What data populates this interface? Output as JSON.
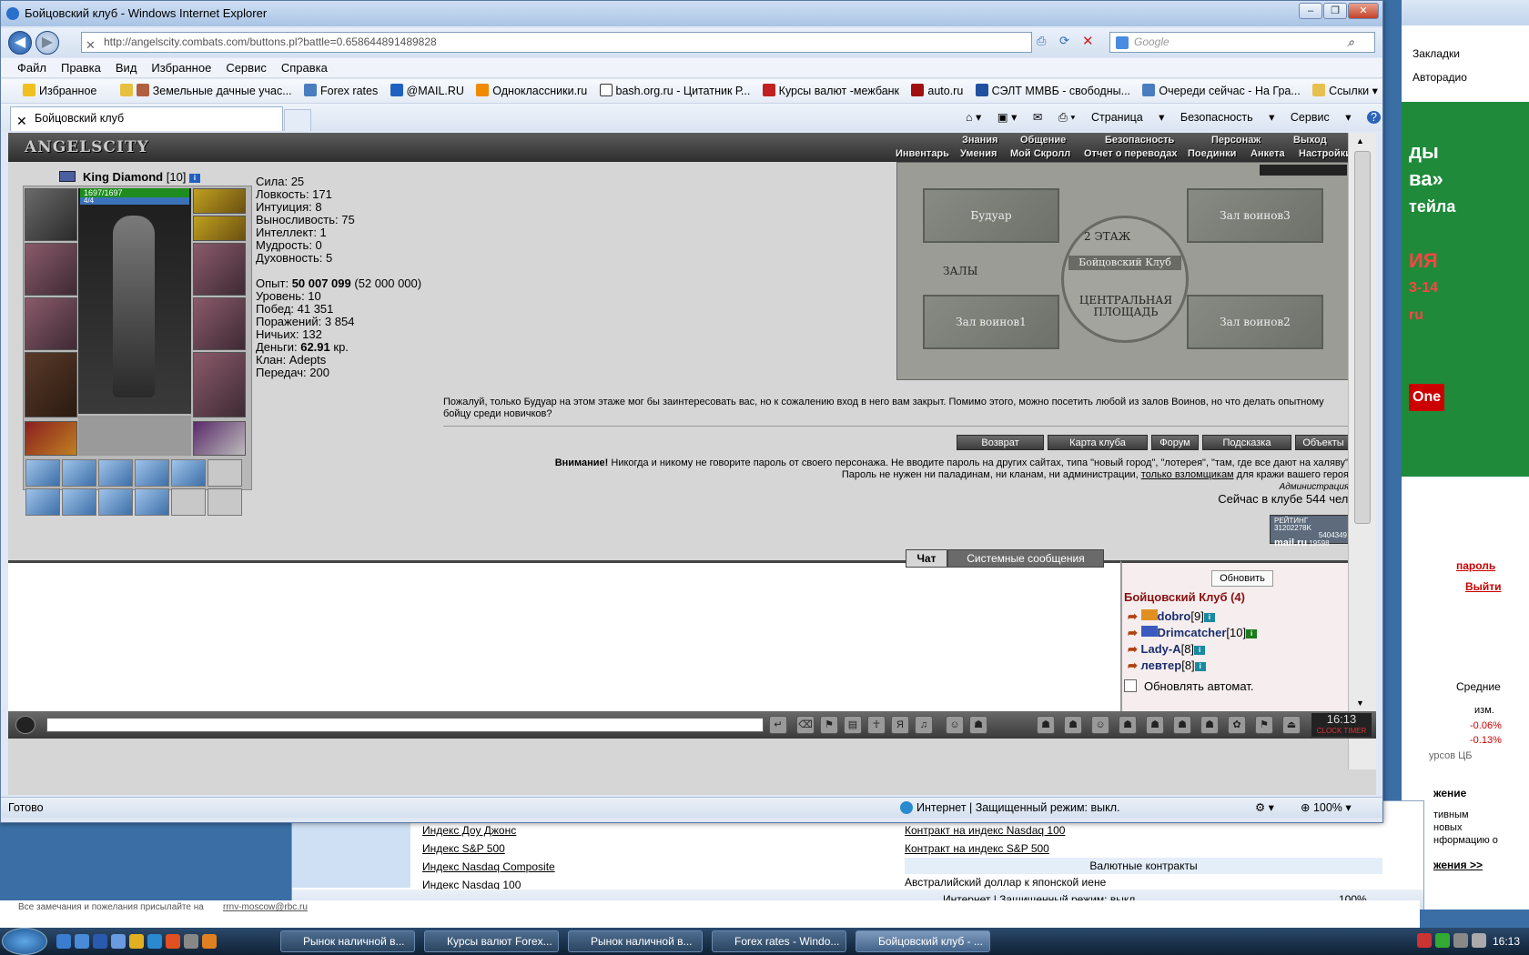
{
  "window": {
    "title": "Бойцовский клуб - Windows Internet Explorer"
  },
  "address": {
    "url": "http://angelscity.combats.com/buttons.pl?battle=0.658644891489828"
  },
  "search": {
    "placeholder": "Google"
  },
  "menu": [
    "Файл",
    "Правка",
    "Вид",
    "Избранное",
    "Сервис",
    "Справка"
  ],
  "favorites": {
    "label": "Избранное",
    "items": [
      "Земельные дачные учас...",
      "Forex rates",
      "@MAIL.RU",
      "Одноклассники.ru",
      "bash.org.ru - Цитатник Р...",
      "Курсы валют -межбанк",
      "auto.ru",
      "СЭЛТ ММВБ - свободны...",
      "Очереди сейчас - На Гра...",
      "Ссылки"
    ]
  },
  "tab": {
    "label": "Бойцовский клуб"
  },
  "commands": [
    "Страница",
    "Безопасность",
    "Сервис"
  ],
  "game": {
    "logo": "ANGELSCITY",
    "menu_top": [
      "Знания",
      "Общение",
      "Безопасность",
      "Персонаж",
      "Выход"
    ],
    "menu_bottom": [
      "Инвентарь",
      "Умения",
      "Мой Скролл",
      "Отчет о переводах",
      "Поединки",
      "Анкета",
      "Настройки"
    ],
    "character": {
      "name": "King Diamond",
      "level": "[10]",
      "hp": "1697/1697",
      "mana": "4/4"
    },
    "stats": {
      "strength": "Сила: 25",
      "agility": "Ловкость: 171",
      "intuition": "Интуиция: 8",
      "endurance": "Выносливость: 75",
      "intellect": "Интеллект: 1",
      "wisdom": "Мудрость: 0",
      "spirit": "Духовность: 5",
      "exp_label": "Опыт: ",
      "exp_value": "50 007 099",
      "exp_next": " (52 000 000)",
      "level": "Уровень: 10",
      "wins": "Побед: 41 351",
      "losses": "Поражений: 3 854",
      "draws": "Ничьих: 132",
      "money_label": "Деньги: ",
      "money_value": "62.91",
      "money_unit": " кр.",
      "clan": "Клан: Adepts",
      "transfers": "Передач: 200"
    },
    "map": {
      "rooms": [
        "Будуар",
        "Зал воинов3",
        "Зал воинов1",
        "Зал воинов2"
      ],
      "floor": "2 ЭТАЖ",
      "center": "Бойцовский Клуб",
      "halls": "ЗАЛЫ",
      "square_1": "ЦЕНТРАЛЬНАЯ",
      "square_2": "ПЛОЩАДЬ"
    },
    "description": "Пожалуй, только Будуар на этом этаже мог бы заинтересовать вас, но к сожалению вход в него вам закрыт. Помимо этого, можно посетить любой из залов Воинов, но что делать опытному бойцу среди новичков?",
    "buttons": [
      "Возврат",
      "Карта клуба",
      "Форум",
      "Подсказка",
      "Объекты"
    ],
    "warning": {
      "bold": "Внимание!",
      "line1": " Никогда и никому не говорите пароль от своего персонажа. Не вводите пароль на других сайтах, типа \"новый город\", \"лотерея\", \"там, где все дают на халяву\".",
      "line2a": "Пароль не нужен ни паладинам, ни кланам, ни администрации, ",
      "line2link": "только взломщикам",
      "line2b": " для кражи вашего героя.",
      "admin": "Администрация."
    },
    "online": "Сейчас в клубе 544 чел.",
    "counter": {
      "label": "РЕЙТИНГ",
      "value1": "31202278K",
      "value2": "5404349",
      "value3": "19598",
      "brand": "mail.ru"
    },
    "chat_tabs": [
      "Чат",
      "Системные сообщения"
    ],
    "refresh": "Обновить",
    "room_title": "Бойцовский Клуб (4)",
    "users": [
      {
        "name": "dobro",
        "level": "[9]"
      },
      {
        "name": "Drimcatcher",
        "level": "[10]"
      },
      {
        "name": "Lady-A",
        "level": "[8]"
      },
      {
        "name": "левтер",
        "level": "[8]"
      }
    ],
    "auto_refresh": "Обновлять автомат.",
    "clock": "16:13",
    "clock_sub": "CLOCK TIMER"
  },
  "status": {
    "left": "Готово",
    "zone": "Интернет | Защищенный режим: выкл.",
    "zoom": "100%"
  },
  "bg_window": {
    "links_left": [
      "Индекс Доу Джонс",
      "Индекс S&P 500",
      "Индекс Nasdaq Composite",
      "Индекс Nasdaq 100"
    ],
    "links_right": [
      "Контракт на индекс Nasdaq 100",
      "Контракт на индекс S&P 500"
    ],
    "section": "Валютные контракты",
    "row": "Австралийский доллар к японской иене",
    "status": "Интернет | Защищенный режим: выкл.",
    "zoom": "100%",
    "footer": "Все замечания и пожелания присылайте на",
    "footer_link": "rrnv-moscow@rbc.ru"
  },
  "right_window": {
    "tab": "Закладки",
    "tab2": "Авторадио",
    "ad_lines": [
      "ды",
      "ва»",
      "тейла",
      "ИЯ",
      "3-14",
      "ru",
      "One"
    ],
    "links": [
      "пароль",
      "Выйти"
    ],
    "avg": "Средние",
    "change": "изм.",
    "val1": "-0.06%",
    "val2": "-0.13%",
    "cb": "урсов ЦБ",
    "news_title": "жение",
    "news": [
      "тивным",
      "новых",
      "нформацию о"
    ],
    "more": "жения >>"
  },
  "taskbar": {
    "tasks": [
      "Рынок наличной в...",
      "Курсы валют Forex...",
      "Рынок наличной в...",
      "Forex rates - Windo...",
      "Бойцовский клуб - ..."
    ],
    "time": "16:13"
  }
}
